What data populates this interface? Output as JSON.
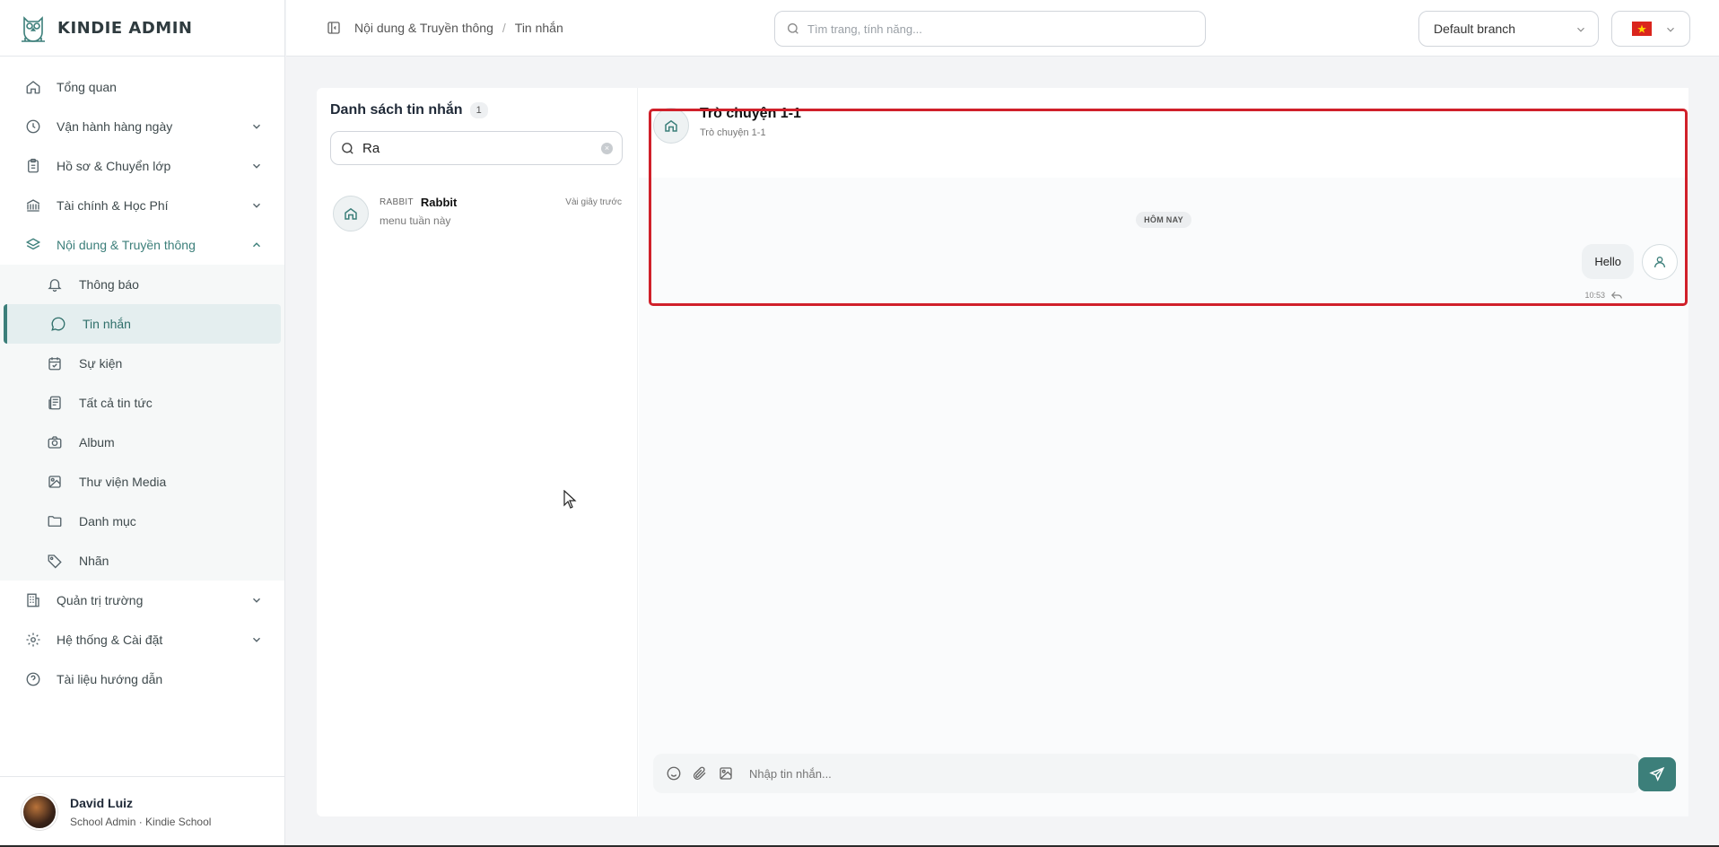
{
  "app": {
    "title": "KINDIE ADMIN"
  },
  "sidebar": {
    "items": [
      {
        "label": "Tổng quan",
        "icon": "home-icon"
      },
      {
        "label": "Vận hành hàng ngày",
        "icon": "clock-icon"
      },
      {
        "label": "Hồ sơ & Chuyển lớp",
        "icon": "clipboard-icon"
      },
      {
        "label": "Tài chính & Học Phí",
        "icon": "bank-icon"
      },
      {
        "label": "Nội dung & Truyền thông",
        "icon": "layers-icon"
      },
      {
        "label": "Quản trị trường",
        "icon": "building-icon"
      },
      {
        "label": "Hệ thống & Cài đặt",
        "icon": "gear-icon"
      },
      {
        "label": "Tài liệu hướng dẫn",
        "icon": "help-icon"
      }
    ],
    "subitems": [
      {
        "label": "Thông báo",
        "icon": "bell-icon"
      },
      {
        "label": "Tin nhắn",
        "icon": "chat-icon"
      },
      {
        "label": "Sự kiện",
        "icon": "calendar-check-icon"
      },
      {
        "label": "Tất cả tin tức",
        "icon": "newspaper-icon"
      },
      {
        "label": "Album",
        "icon": "camera-icon"
      },
      {
        "label": "Thư viện Media",
        "icon": "image-icon"
      },
      {
        "label": "Danh mục",
        "icon": "folder-icon"
      },
      {
        "label": "Nhãn",
        "icon": "tag-icon"
      }
    ]
  },
  "user": {
    "name": "David Luiz",
    "role": "School Admin · Kindie School"
  },
  "topbar": {
    "breadcrumb": {
      "parent": "Nội dung & Truyền thông",
      "separator": "/",
      "current": "Tin nhắn"
    },
    "search_placeholder": "Tìm trang, tính năng...",
    "branch": "Default branch"
  },
  "messages_list": {
    "title": "Danh sách tin nhắn",
    "count": "1",
    "search_value": "Ra",
    "conversations": [
      {
        "tag": "RABBIT",
        "name": "Rabbit",
        "time": "Vài giây trước",
        "preview": "menu tuần này"
      }
    ]
  },
  "chat": {
    "title": "Trò chuyện 1-1",
    "subtitle": "Trò chuyện 1-1",
    "date_divider": "HÔM NAY",
    "message": {
      "text": "Hello",
      "time": "10:53"
    },
    "composer_placeholder": "Nhập tin nhắn..."
  },
  "colors": {
    "accent": "#3c7f7a",
    "highlight": "#d0202a",
    "flag": "#da251d"
  }
}
